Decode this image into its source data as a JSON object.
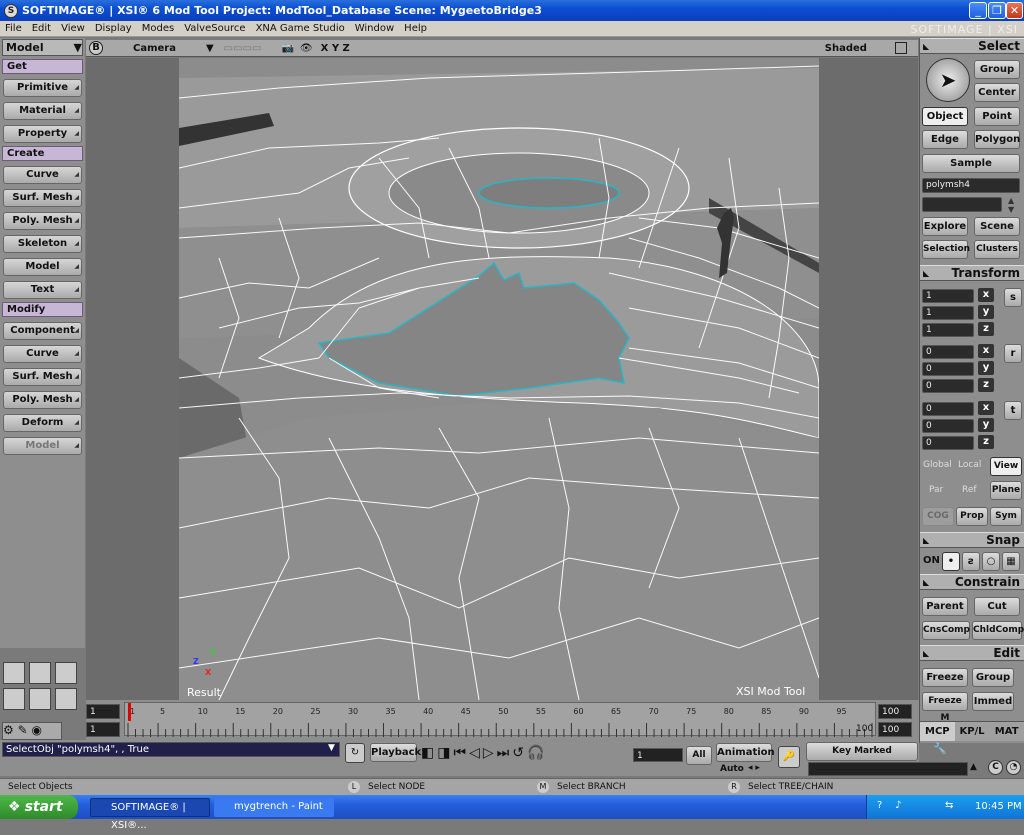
{
  "title_bar": {
    "text": "SOFTIMAGE® | XSI® 6 Mod Tool Project: ModTool_Database    Scene: MygeetoBridge3"
  },
  "brand": "SOFTIMAGE | XSI",
  "menu": [
    "File",
    "Edit",
    "View",
    "Display",
    "Modes",
    "ValveSource",
    "XNA Game Studio",
    "Window",
    "Help"
  ],
  "left_panel": {
    "mode": "Model",
    "sections": [
      {
        "title": "Get",
        "buttons": [
          "Primitive",
          "Material",
          "Property"
        ]
      },
      {
        "title": "Create",
        "buttons": [
          "Curve",
          "Surf. Mesh",
          "Poly. Mesh",
          "Skeleton",
          "Model",
          "Text"
        ]
      },
      {
        "title": "Modify",
        "buttons": [
          "Component",
          "Curve",
          "Surf. Mesh",
          "Poly. Mesh",
          "Deform",
          "Model"
        ]
      }
    ]
  },
  "viewport": {
    "letter": "B",
    "camera": "Camera",
    "axes": "X Y Z",
    "display_mode": "Shaded",
    "label_left": "Result",
    "label_right": "XSI Mod Tool",
    "gizmo": {
      "x": "X",
      "y": "Y",
      "z": "Z"
    }
  },
  "right_panel": {
    "select_header": "Select",
    "group": "Group",
    "center": "Center",
    "object": "Object",
    "point": "Point",
    "edge": "Edge",
    "polygon": "Polygon",
    "sample": "Sample",
    "selected_name": "polymsh4",
    "explore": "Explore",
    "scene": "Scene",
    "selection": "Selection",
    "clusters": "Clusters",
    "transform_header": "Transform",
    "scale": {
      "x": "1",
      "y": "1",
      "z": "1",
      "label": "s"
    },
    "rotate": {
      "x": "0",
      "y": "0",
      "z": "0",
      "label": "r"
    },
    "translate": {
      "x": "0",
      "y": "0",
      "z": "0",
      "label": "t"
    },
    "global": "Global",
    "local": "Local",
    "view": "View",
    "par": "Par",
    "ref": "Ref",
    "plane": "Plane",
    "cog": "COG",
    "prop": "Prop",
    "sym": "Sym",
    "snap_header": "Snap",
    "snap_on": "ON",
    "constrain_header": "Constrain",
    "parent": "Parent",
    "cut": "Cut",
    "cnscomp": "CnsComp",
    "chldcomp": "ChldComp",
    "edit_header": "Edit",
    "freeze": "Freeze",
    "group2": "Group",
    "freezem": "Freeze M",
    "immed": "Immed",
    "tabs": [
      "MCP",
      "KP/L",
      "MAT"
    ]
  },
  "timeline": {
    "start": "1",
    "current": "1",
    "end": "100",
    "end2": "100",
    "ticks": [
      "1",
      "5",
      "10",
      "15",
      "20",
      "25",
      "30",
      "35",
      "40",
      "45",
      "50",
      "55",
      "60",
      "65",
      "70",
      "75",
      "80",
      "85",
      "90",
      "95"
    ],
    "playhead_fraction": 0.0
  },
  "command": {
    "text": "SelectObj \"polymsh4\", , True",
    "playback": "Playback",
    "frame": "1",
    "all": "All",
    "animation": "Animation",
    "auto": "Auto",
    "key_marked": "Key Marked Parameters"
  },
  "status": {
    "left": "Select Objects",
    "l_key": "L",
    "l_text": "Select NODE",
    "m_key": "M",
    "m_text": "Select BRANCH",
    "r_key": "R",
    "r_text": "Select TREE/CHAIN"
  },
  "taskbar": {
    "start": "start",
    "tasks": [
      "SOFTIMAGE® | XSI®...",
      "mygtrench - Paint"
    ],
    "clock": "10:45 PM"
  }
}
